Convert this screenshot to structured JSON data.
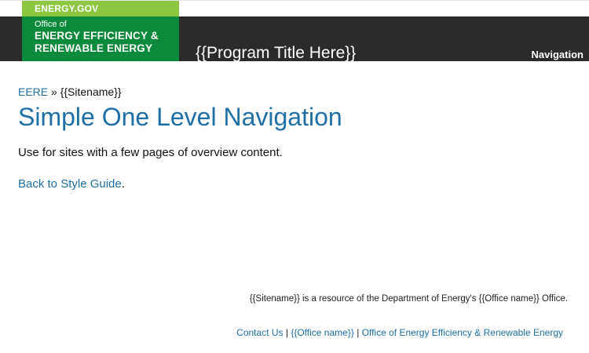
{
  "header": {
    "logo_top": "ENERGY.GOV",
    "logo_office": "Office of",
    "logo_line1": "ENERGY EFFICIENCY &",
    "logo_line2": "RENEWABLE ENERGY",
    "program_title": "{{Program Title Here}}",
    "nav_label": "Navigation"
  },
  "breadcrumb": {
    "home": "EERE",
    "separator": "»",
    "current": "{{Sitename}}"
  },
  "main": {
    "title": "Simple One Level Navigation",
    "intro": "Use for sites with a few pages of overview content.",
    "back_link": "Back to Style Guide",
    "back_suffix": "."
  },
  "footer": {
    "resource_text": "{{Sitename}} is a resource of the Department of Energy's {{Office name}} Office.",
    "links": [
      {
        "label": "Contact Us"
      },
      {
        "label": "{{Office name}}"
      },
      {
        "label": "Office of Energy Efficiency & Renewable Energy"
      }
    ],
    "link_separator": "|"
  },
  "colors": {
    "header_bg": "#2b2b2b",
    "logo_top_bg": "#8dc63f",
    "logo_bottom_bg": "#0a8a3a",
    "link": "#1d6fa5"
  }
}
